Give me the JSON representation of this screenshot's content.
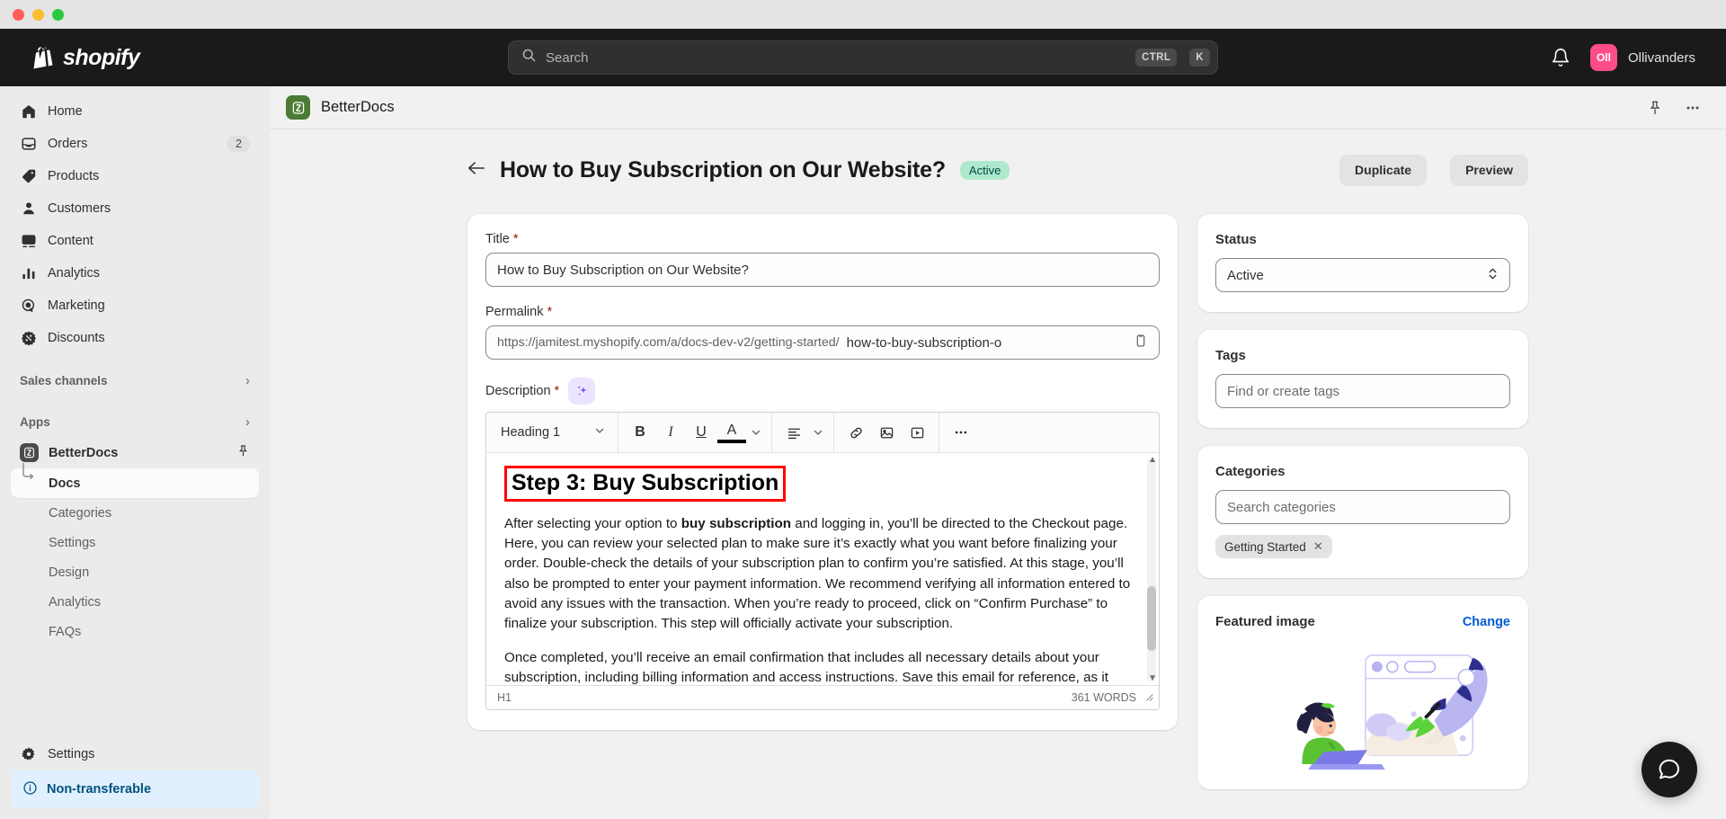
{
  "window": {
    "traffic_lights": [
      "close",
      "minimize",
      "maximize"
    ]
  },
  "topbar": {
    "brand": "shopify",
    "search": {
      "placeholder": "Search",
      "shortcut_ctrl": "CTRL",
      "shortcut_key": "K"
    },
    "notifications_icon": "bell-icon",
    "user": {
      "initials": "Oll",
      "name": "Ollivanders",
      "avatar_color": "#ff4e87"
    }
  },
  "sidebar": {
    "nav": [
      {
        "label": "Home",
        "icon": "home-icon",
        "badge": ""
      },
      {
        "label": "Orders",
        "icon": "orders-icon",
        "badge": "2"
      },
      {
        "label": "Products",
        "icon": "products-icon",
        "badge": ""
      },
      {
        "label": "Customers",
        "icon": "customers-icon",
        "badge": ""
      },
      {
        "label": "Content",
        "icon": "content-icon",
        "badge": ""
      },
      {
        "label": "Analytics",
        "icon": "analytics-icon",
        "badge": ""
      },
      {
        "label": "Marketing",
        "icon": "marketing-icon",
        "badge": ""
      },
      {
        "label": "Discounts",
        "icon": "discounts-icon",
        "badge": ""
      }
    ],
    "sales_channels": "Sales channels",
    "apps": "Apps",
    "app": {
      "label": "BetterDocs",
      "pin_icon": "pin-icon"
    },
    "app_children": [
      {
        "label": "Docs",
        "active": true
      },
      {
        "label": "Categories",
        "active": false
      },
      {
        "label": "Settings",
        "active": false
      },
      {
        "label": "Design",
        "active": false
      },
      {
        "label": "Analytics",
        "active": false
      },
      {
        "label": "FAQs",
        "active": false
      }
    ],
    "settings": {
      "label": "Settings",
      "icon": "gear-icon"
    },
    "notice": {
      "label": "Non-transferable",
      "icon": "info-icon",
      "bg": "#e0f0ff",
      "fg": "#00527c"
    }
  },
  "app_header": {
    "title": "BetterDocs",
    "icon": "betterdocs-icon",
    "pin_icon": "pin-icon",
    "more_icon": "more-horizontal-icon"
  },
  "page": {
    "back_icon": "arrow-left-icon",
    "title": "How to Buy Subscription on Our Website?",
    "status_badge": "Active",
    "status_badge_bg": "#aee9cd",
    "buttons": {
      "duplicate": "Duplicate",
      "preview": "Preview"
    }
  },
  "form": {
    "title_label": "Title",
    "title_required": "*",
    "title_value": "How to Buy Subscription on Our Website?",
    "permalink_label": "Permalink",
    "permalink_required": "*",
    "permalink_prefix": "https://jamitest.myshopify.com/a/docs-dev-v2/getting-started/",
    "permalink_slug": "how-to-buy-subscription-o",
    "copy_icon": "copy-icon",
    "description_label": "Description",
    "description_required": "*",
    "ai_icon": "ai-sparkle-icon"
  },
  "editor": {
    "toolbar": {
      "block_format": "Heading 1",
      "bold": "B",
      "italic": "I",
      "underline": "U",
      "text_color": "A",
      "align_icon": "align-left-icon",
      "link_icon": "link-icon",
      "image_icon": "image-icon",
      "video_icon": "video-icon",
      "more_icon": "more-horizontal-icon"
    },
    "content": {
      "heading": "Step 3: Buy Subscription",
      "paragraph1_part1": "After selecting your option to ",
      "paragraph1_bold": "buy subscription",
      "paragraph1_part2": " and logging in, you’ll be directed to the Checkout page. Here, you can review your selected plan to make sure it’s exactly what you want before finalizing your order. Double-check the details of your subscription plan to confirm you’re satisfied. At this stage, you’ll also be prompted to enter your payment information. We recommend verifying all information entered to avoid any issues with the transaction. When you’re ready to proceed, click on “Confirm Purchase” to finalize your subscription. This step will officially activate your subscription.",
      "paragraph2": "Once completed, you’ll receive an email confirmation that includes all necessary details about your subscription, including billing information and access instructions. Save this email for reference, as it provides essential information on managing and maximizing"
    },
    "footer": {
      "block_tag": "H1",
      "word_count": "361 WORDS"
    }
  },
  "side": {
    "status": {
      "title": "Status",
      "value": "Active"
    },
    "tags": {
      "title": "Tags",
      "placeholder": "Find or create tags"
    },
    "categories": {
      "title": "Categories",
      "placeholder": "Search categories",
      "chips": [
        {
          "label": "Getting Started",
          "remove_icon": "close-icon"
        }
      ]
    },
    "featured": {
      "title": "Featured image",
      "change_label": "Change",
      "illustration": "rocket-laptop-illustration"
    }
  },
  "chat": {
    "icon": "chat-bubble-icon"
  }
}
